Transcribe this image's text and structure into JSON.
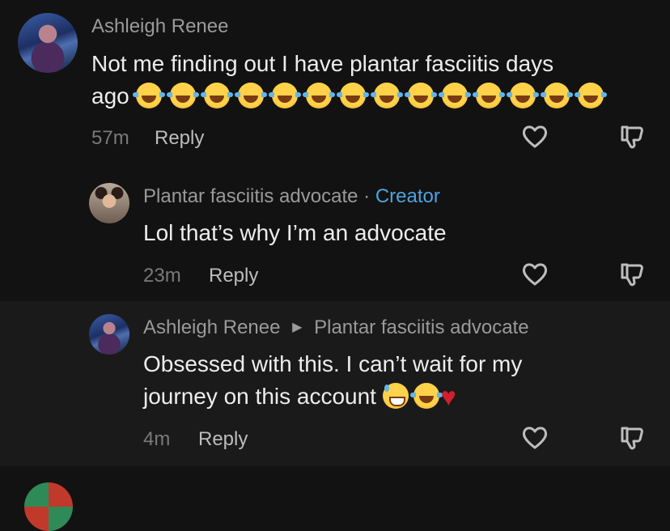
{
  "comments": [
    {
      "username": "Ashleigh Renee",
      "text": "Not me finding out I have plantar fasciitis days",
      "text_line2": "ago",
      "emoji_count": 14,
      "time": "57m",
      "reply_label": "Reply"
    },
    {
      "username": "Plantar fasciitis advocate",
      "separator": "·",
      "badge": "Creator",
      "text": "Lol that’s why I’m an advocate",
      "time": "23m",
      "reply_label": "Reply"
    },
    {
      "username": "Ashleigh Renee",
      "reply_to": "Plantar fasciitis advocate",
      "text": "Obsessed with this. I can’t wait for my",
      "text_line2": "journey on this account",
      "time": "4m",
      "reply_label": "Reply"
    }
  ],
  "icons": {
    "like": "heart-outline-icon",
    "dislike": "thumbs-down-icon",
    "reply_to": "triangle-right-icon"
  },
  "colors": {
    "background": "#121212",
    "creator_badge": "#4da3e0",
    "heart_emoji": "#d11f2e"
  }
}
